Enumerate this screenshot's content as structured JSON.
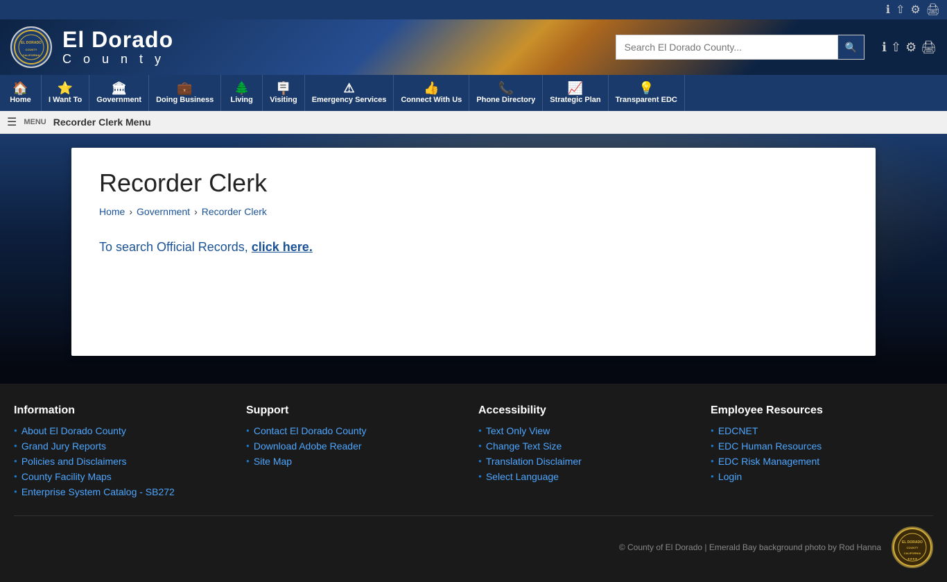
{
  "site": {
    "title_main": "El Dorado",
    "title_sub": "C o u n t y",
    "search_placeholder": "Search El Dorado County...",
    "search_btn_label": "🔍"
  },
  "header_icons": {
    "info": "ℹ",
    "share": "⟨⟩",
    "settings": "⚙",
    "print": "🖶"
  },
  "nav": {
    "items": [
      {
        "icon": "🏠",
        "label": "Home"
      },
      {
        "icon": "⭐",
        "label": "I Want To"
      },
      {
        "icon": "🏛",
        "label": "Government"
      },
      {
        "icon": "💼",
        "label": "Doing Business"
      },
      {
        "icon": "🌲",
        "label": "Living"
      },
      {
        "icon": "🪧",
        "label": "Visiting"
      },
      {
        "icon": "⚠",
        "label": "Emergency Services"
      },
      {
        "icon": "👍",
        "label": "Connect With Us"
      },
      {
        "icon": "📞",
        "label": "Phone Directory"
      },
      {
        "icon": "📈",
        "label": "Strategic Plan"
      },
      {
        "icon": "💡",
        "label": "Transparent EDC"
      }
    ]
  },
  "menu_bar": {
    "label": "Recorder Clerk Menu"
  },
  "main": {
    "page_title": "Recorder Clerk",
    "breadcrumb": {
      "home": "Home",
      "government": "Government",
      "current": "Recorder Clerk"
    },
    "search_text_prefix": "To search Official Records, ",
    "search_link_text": "click here.",
    "search_link_suffix": ""
  },
  "footer": {
    "information": {
      "heading": "Information",
      "links": [
        "About El Dorado County",
        "Grand Jury Reports",
        "Policies and Disclaimers",
        "County Facility Maps",
        "Enterprise System Catalog - SB272"
      ]
    },
    "support": {
      "heading": "Support",
      "links": [
        "Contact El Dorado County",
        "Download Adobe Reader",
        "Site Map"
      ]
    },
    "accessibility": {
      "heading": "Accessibility",
      "links": [
        "Text Only View",
        "Change Text Size",
        "Translation Disclaimer",
        "Select Language"
      ]
    },
    "employee_resources": {
      "heading": "Employee Resources",
      "links": [
        "EDCNET",
        "EDC Human Resources",
        "EDC Risk Management",
        "Login"
      ]
    },
    "copyright": "© County of El Dorado | Emerald Bay background photo by Rod Hanna"
  }
}
